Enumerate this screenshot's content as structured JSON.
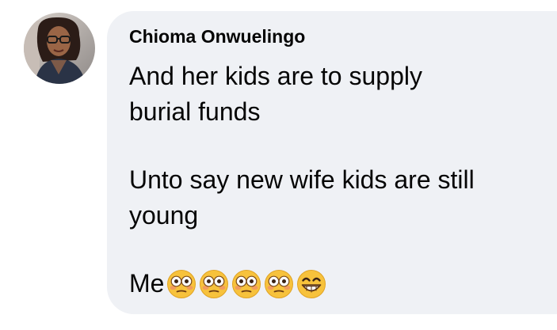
{
  "comment": {
    "author": "Chioma Onwuelingo",
    "paragraphs": [
      {
        "lines": [
          "And her kids are to supply",
          "burial funds"
        ]
      },
      {
        "lines": [
          "Unto say new wife kids are still",
          "young"
        ]
      }
    ],
    "last_line": {
      "text": "Me",
      "emojis": [
        "flushed-face",
        "flushed-face",
        "flushed-face",
        "flushed-face",
        "grinning-face-with-smiling-eyes"
      ]
    }
  },
  "colors": {
    "bubble_background": "#eff1f5",
    "text": "#050505",
    "emoji_yellow": "#f7c23c"
  }
}
